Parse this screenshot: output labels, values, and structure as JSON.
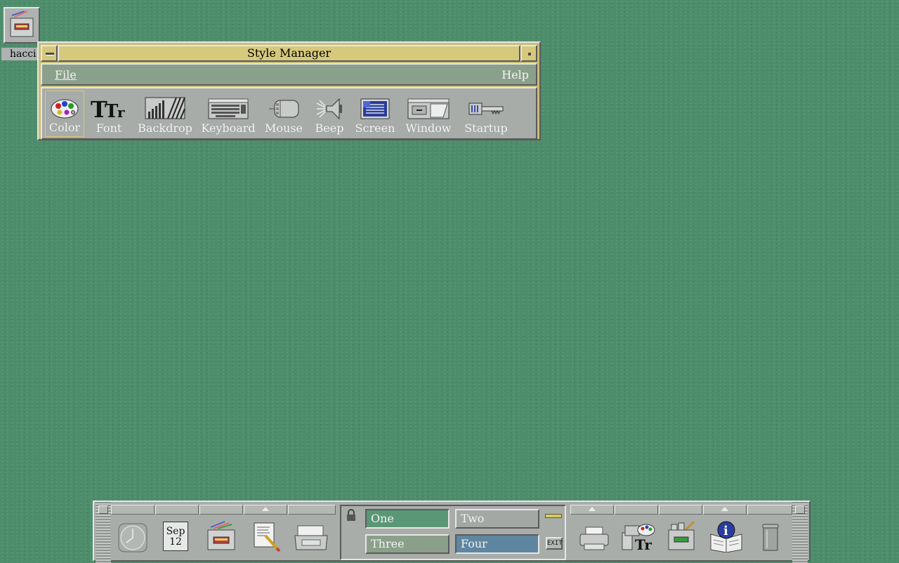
{
  "desktop": {
    "icon_label": "hacci"
  },
  "style_manager": {
    "title": "Style Manager",
    "menus": {
      "file": "File",
      "help": "Help"
    },
    "tools": [
      {
        "id": "color",
        "label": "Color",
        "icon": "palette-icon"
      },
      {
        "id": "font",
        "label": "Font",
        "icon": "font-icon"
      },
      {
        "id": "backdrop",
        "label": "Backdrop",
        "icon": "backdrop-icon"
      },
      {
        "id": "keyboard",
        "label": "Keyboard",
        "icon": "keyboard-icon"
      },
      {
        "id": "mouse",
        "label": "Mouse",
        "icon": "mouse-icon"
      },
      {
        "id": "beep",
        "label": "Beep",
        "icon": "speaker-icon"
      },
      {
        "id": "screen",
        "label": "Screen",
        "icon": "screen-icon"
      },
      {
        "id": "window",
        "label": "Window",
        "icon": "window-icon"
      },
      {
        "id": "startup",
        "label": "Startup",
        "icon": "key-icon"
      }
    ],
    "selected": "Color"
  },
  "front_panel": {
    "calendar": {
      "month": "Sep",
      "day": "12"
    },
    "workspaces": [
      "One",
      "Two",
      "Three",
      "Four"
    ],
    "active_workspace": "Four",
    "exit_label": "EXIT"
  },
  "colors": {
    "desktop": "#4e8d6b",
    "titlebar": "#d6c97c",
    "menubar": "#8aa08a",
    "panel": "#a9adaa",
    "ws_one": "#5a9776",
    "ws_two": "#a3a8a5",
    "ws_three": "#8aa08a",
    "ws_four": "#5f86a0"
  }
}
